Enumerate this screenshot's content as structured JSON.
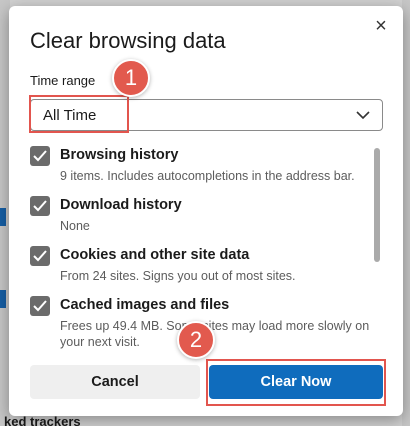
{
  "dialog": {
    "title": "Clear browsing data",
    "close_label": "×"
  },
  "time_range": {
    "label": "Time range",
    "selected": "All Time"
  },
  "items": [
    {
      "title": "Browsing history",
      "desc": "9 items. Includes autocompletions in the address bar.",
      "checked": true
    },
    {
      "title": "Download history",
      "desc": "None",
      "checked": true
    },
    {
      "title": "Cookies and other site data",
      "desc": "From 24 sites. Signs you out of most sites.",
      "checked": true
    },
    {
      "title": "Cached images and files",
      "desc": "Frees up 49.4 MB. Some sites may load more slowly on your next visit.",
      "checked": true
    }
  ],
  "buttons": {
    "cancel": "Cancel",
    "clear": "Clear Now"
  },
  "annotations": {
    "badge_1": "1",
    "badge_2": "2",
    "color": "#e2554e"
  },
  "background": {
    "bottom_text": "ked trackers",
    "accent": "#1a73c9"
  },
  "colors": {
    "primary": "#0f6cbd",
    "checkbox": "#6b6b6b"
  }
}
